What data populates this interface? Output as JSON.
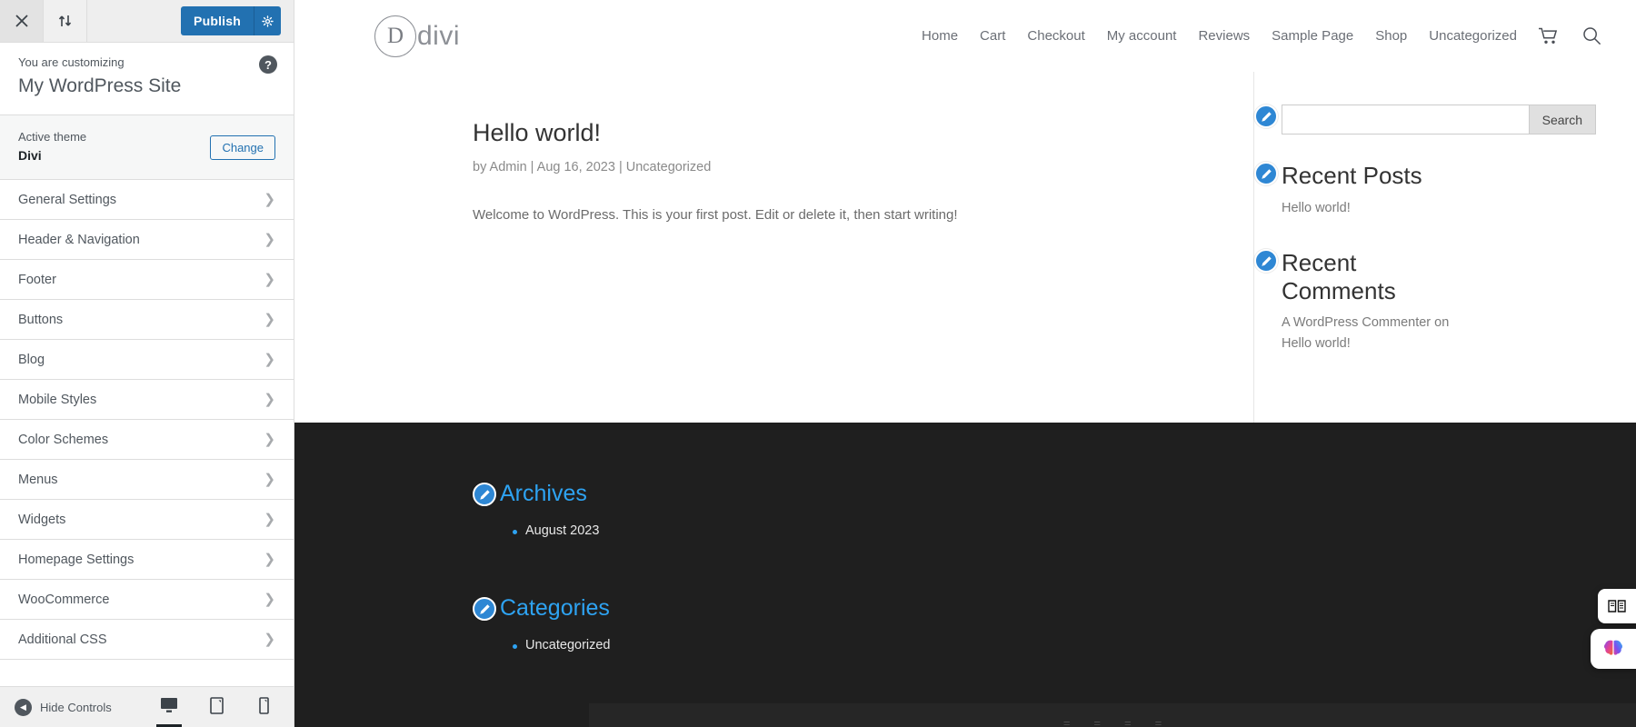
{
  "customizer": {
    "topbar": {
      "close_icon": "close-icon",
      "collapse_icon": "sort-updown-icon",
      "publish_label": "Publish",
      "publish_gear_icon": "gear-icon"
    },
    "header": {
      "subtitle": "You are customizing",
      "site_title": "My WordPress Site",
      "help_icon": "help-icon",
      "help_label": "?"
    },
    "theme": {
      "label": "Active theme",
      "name": "Divi",
      "change_label": "Change"
    },
    "sections": [
      {
        "label": "General Settings"
      },
      {
        "label": "Header & Navigation"
      },
      {
        "label": "Footer"
      },
      {
        "label": "Buttons"
      },
      {
        "label": "Blog"
      },
      {
        "label": "Mobile Styles"
      },
      {
        "label": "Color Schemes"
      },
      {
        "label": "Menus"
      },
      {
        "label": "Widgets"
      },
      {
        "label": "Homepage Settings"
      },
      {
        "label": "WooCommerce"
      },
      {
        "label": "Additional CSS"
      }
    ],
    "footer": {
      "hide_controls_label": "Hide Controls",
      "devices": [
        {
          "name": "desktop",
          "active": true
        },
        {
          "name": "tablet",
          "active": false
        },
        {
          "name": "mobile",
          "active": false
        }
      ]
    }
  },
  "preview": {
    "site_header": {
      "logo_mark": "D",
      "logo_text": "divi",
      "nav": [
        {
          "label": "Home"
        },
        {
          "label": "Cart"
        },
        {
          "label": "Checkout"
        },
        {
          "label": "My account"
        },
        {
          "label": "Reviews"
        },
        {
          "label": "Sample Page"
        },
        {
          "label": "Shop"
        },
        {
          "label": "Uncategorized"
        }
      ],
      "cart_icon": "shopping-cart-icon",
      "search_icon": "search-icon"
    },
    "post": {
      "title": "Hello world!",
      "meta": "by Admin | Aug 16, 2023 | Uncategorized",
      "body": "Welcome to WordPress. This is your first post. Edit or delete it, then start writing!"
    },
    "sidebar": {
      "search": {
        "value": "",
        "placeholder": "",
        "button_label": "Search"
      },
      "recent_posts": {
        "title": "Recent Posts",
        "items": [
          "Hello world!"
        ]
      },
      "recent_comments": {
        "title": "Recent Comments",
        "items": [
          "A WordPress Commenter on Hello world!"
        ]
      }
    },
    "footer": {
      "archives": {
        "title": "Archives",
        "items": [
          "August 2023"
        ]
      },
      "categories": {
        "title": "Categories",
        "items": [
          "Uncategorized"
        ]
      }
    }
  },
  "overlay": {
    "book_button_icon": "book-icon",
    "brain_button_icon": "brain-icon"
  },
  "colors": {
    "accent_blue": "#2ea3f2",
    "publish_blue": "#2271b1",
    "pencil_blue": "#2e87d4",
    "footer_dark": "#1f1f1f"
  }
}
